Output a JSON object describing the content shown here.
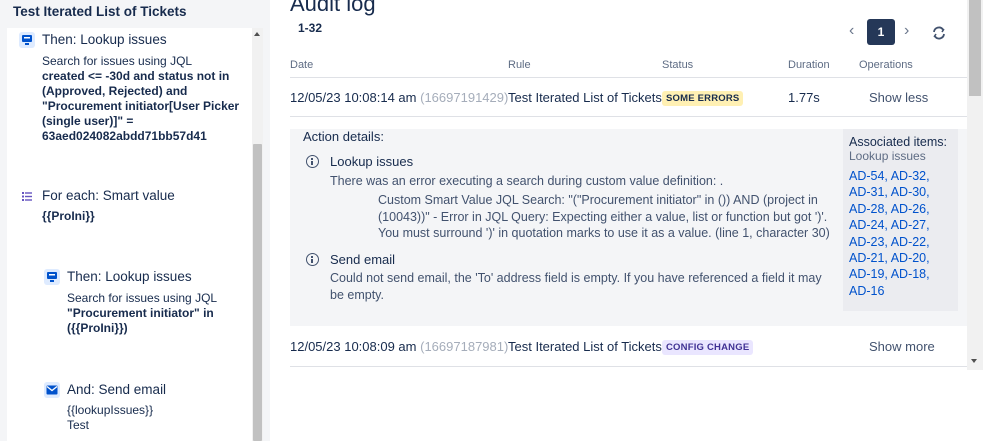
{
  "sidebar": {
    "title": "Test Iterated List of Tickets",
    "steps": [
      {
        "heading": "Then: Lookup issues",
        "desc": "Search for issues using JQL",
        "query": "created <= -30d and status not in (Approved, Rejected) and \"Procurement initiator[User Picker (single user)]\" = 63aed024082abdd71bb57d41"
      },
      {
        "heading": "For each: Smart value",
        "query": "{{ProIni}}"
      },
      {
        "heading": "Then: Lookup issues",
        "desc": "Search for issues using JQL",
        "query": "\"Procurement initiator\" in ({{ProIni}})"
      },
      {
        "heading": "And: Send email",
        "line1": "{{lookupIssues}}",
        "line2": "Test"
      }
    ]
  },
  "audit": {
    "title": "Audit log",
    "range": "1-32",
    "pagination": {
      "prev": "‹",
      "current_page": "1",
      "next": "›"
    },
    "columns": [
      "Date",
      "Rule",
      "Status",
      "Duration",
      "Operations"
    ],
    "rows": [
      {
        "date": "12/05/23 10:08:14 am",
        "id": "(16697191429)",
        "rule": "Test Iterated List of Tickets",
        "status": "SOME ERRORS",
        "duration": "1.77s",
        "operation": "Show less"
      },
      {
        "date": "12/05/23 10:08:09 am",
        "id": "(16697187981)",
        "rule": "Test Iterated List of Tickets",
        "status": "CONFIG CHANGE",
        "duration": "",
        "operation": "Show more"
      }
    ],
    "details": {
      "title": "Action details:",
      "items": [
        {
          "heading": "Lookup issues",
          "message": "There was an error executing a search during custom value definition: .",
          "detail": "Custom Smart Value JQL Search: \"(\"Procurement initiator\" in ()) AND (project in (10043))\" - Error in JQL Query: Expecting either a value, list or function but got ')'. You must surround ')' in quotation marks to use it as a value. (line 1, character 30)"
        },
        {
          "heading": "Send email",
          "message": "Could not send email, the 'To' address field is empty. If you have referenced a field it may be empty."
        }
      ],
      "associated": {
        "title": "Associated items:",
        "subtitle": "Lookup issues",
        "links": [
          "AD-54,",
          "AD-32,",
          "AD-31,",
          "AD-30,",
          "AD-28,",
          "AD-26,",
          "AD-24,",
          "AD-27,",
          "AD-23,",
          "AD-22,",
          "AD-21,",
          "AD-20,",
          "AD-19,",
          "AD-18,",
          "AD-16"
        ]
      }
    }
  },
  "colors": {
    "sidebar_bg": "#f4f5f7",
    "text": "#172b4d",
    "link": "#0052cc",
    "badge_errors_bg": "#fff0b3",
    "badge_config_bg": "#eae6ff",
    "page_button_bg": "#253858"
  },
  "icons": {
    "lookup": "lookup-action-icon",
    "foreach": "branch-list-icon",
    "email": "envelope-icon",
    "info": "info-icon",
    "refresh": "refresh-icon"
  }
}
